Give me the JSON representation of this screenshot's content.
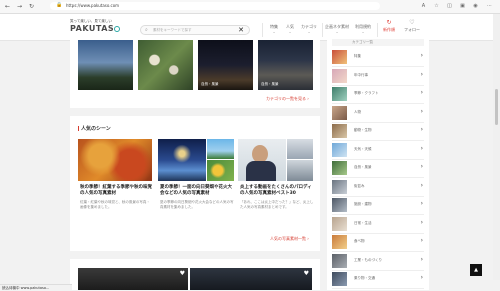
{
  "browser": {
    "url": "https://www.pakutaso.com",
    "back_icon": "back-arrow-icon",
    "reload_icon": "reload-icon"
  },
  "header": {
    "tagline": "笑って楽しい、見て楽しい",
    "logo_text": "PAKUTAS",
    "search_placeholder": "素材をキーワードで探す",
    "nav": [
      {
        "label": "特集",
        "caret": "⌄"
      },
      {
        "label": "人気",
        "caret": "⌄"
      },
      {
        "label": "カテゴリ",
        "caret": "⌄"
      },
      {
        "label": "企画ネタ素材",
        "caret": "⌄"
      },
      {
        "label": "利用規約",
        "caret": "⌄"
      },
      {
        "label": "新作順",
        "caret": ""
      },
      {
        "label": "フォロー",
        "caret": ""
      }
    ]
  },
  "category_section": {
    "overlay_labels": [
      "自然・風景",
      "自然・風景"
    ],
    "more_link": "カテゴリの一覧を見る ›"
  },
  "popular_scenes": {
    "heading": "人気のシーン",
    "cards": [
      {
        "title": "秋の季節！紅葉する季節や秋の味覚の人気の写真素材",
        "desc": "紅葉・紅葉や秋の味覚と、秋の風景の写真・画像を集めました。"
      },
      {
        "title": "夏の季節！一面の向日葵畑や花火大会などの人気の写真素材",
        "desc": "夏の季節の向日葵畑や花火大会などの人気の写真素材を集めました。"
      },
      {
        "title": "炎上する動画をたくさんのパロディの人気の写真素材ベスト30",
        "desc": "「あれ、ここは炎上中だった？」など、炎上した人気の写真素材まとめです。"
      }
    ],
    "more_link": "人気の写真素材一覧 ›"
  },
  "sidebar": {
    "header": "カテゴリ一覧",
    "items": [
      "特集",
      "年中行事",
      "季節・クラフト",
      "人物",
      "動物・生物",
      "天気・天候",
      "自然・風景",
      "街並み",
      "施設・建物",
      "日常・生活",
      "食べ物",
      "工業・ものづくり",
      "乗り物・交通"
    ]
  },
  "status_text": "読込待機中 www.pakutaso...",
  "colors": {
    "accent": "#d63b2f",
    "logo_ring": "#2aa7a5"
  }
}
